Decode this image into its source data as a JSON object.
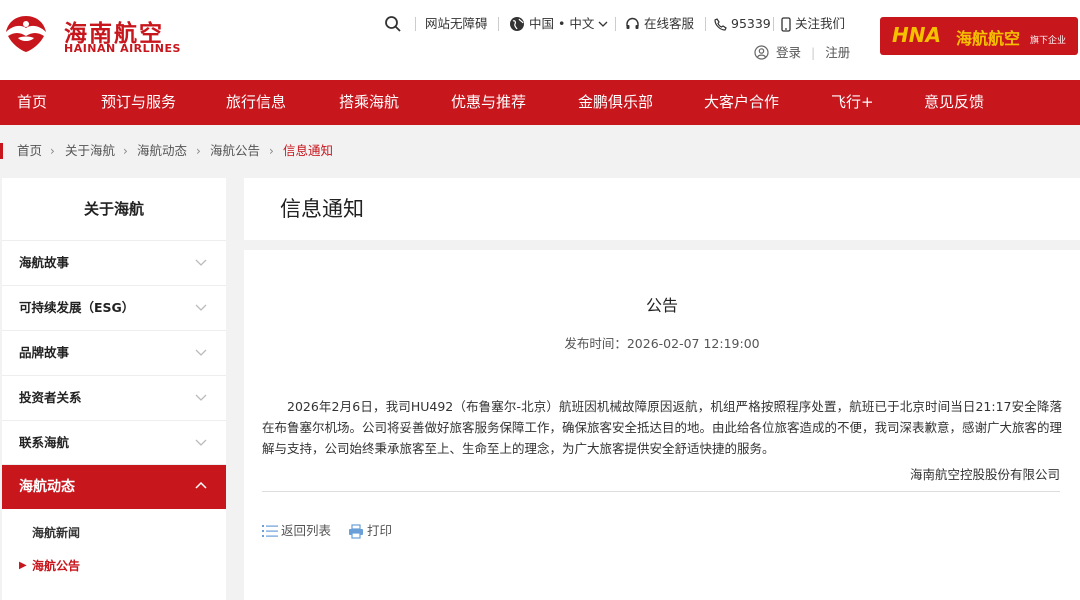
{
  "header": {
    "logo_cn": "海南航空",
    "logo_en": "HAINAN AIRLINES",
    "topbar": {
      "accessibility": "网站无障碍",
      "region": "中国 • 中文",
      "service": "在线客服",
      "phone": "95339",
      "follow": "关注我们",
      "login": "登录",
      "register": "注册"
    },
    "brand": {
      "hna": "HNA",
      "name": "海航航空",
      "sub": "旗下企业"
    }
  },
  "nav": {
    "items": [
      "首页",
      "预订与服务",
      "旅行信息",
      "搭乘海航",
      "优惠与推荐",
      "金鹏俱乐部",
      "大客户合作",
      "飞行+",
      "意见反馈"
    ]
  },
  "breadcrumb": {
    "items": [
      "首页",
      "关于海航",
      "海航动态",
      "海航公告",
      "信息通知"
    ]
  },
  "sidebar": {
    "title": "关于海航",
    "items": [
      "海航故事",
      "可持续发展（ESG）",
      "品牌故事",
      "投资者关系",
      "联系海航",
      "海航动态"
    ],
    "subitems": [
      "海航新闻",
      "海航公告"
    ]
  },
  "main": {
    "page_title": "信息通知",
    "notice_title": "公告",
    "publish_time": "发布时间：2026-02-07 12:19:00",
    "body": "2026年2月6日，我司HU492（布鲁塞尔-北京）航班因机械故障原因返航，机组严格按照程序处置，航班已于北京时间当日21:17安全降落在布鲁塞尔机场。公司将妥善做好旅客服务保障工作，确保旅客安全抵达目的地。由此给各位旅客造成的不便，我司深表歉意，感谢广大旅客的理解与支持，公司始终秉承旅客至上、生命至上的理念，为广大旅客提供安全舒适快捷的服务。",
    "signature": "海南航空控股股份有限公司",
    "back_label": "返回列表",
    "print_label": "打印"
  },
  "colors": {
    "brand_red": "#c8161d",
    "brand_gold": "#f5c000"
  }
}
